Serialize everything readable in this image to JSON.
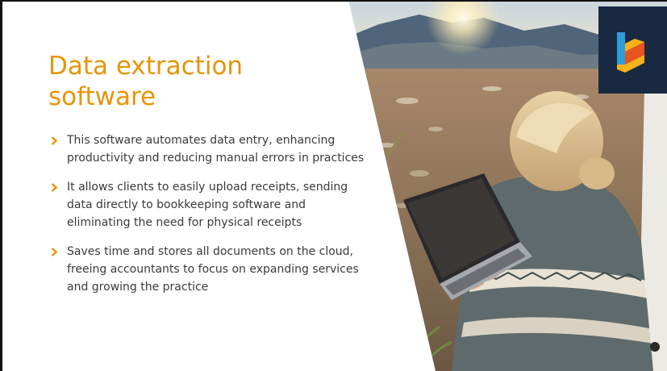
{
  "slide": {
    "title": "Data extraction software",
    "bullets": [
      "This software automates data entry, enhancing productivity and reducing manual errors in practices",
      "It allows clients to easily upload receipts, sending data directly to bookkeeping software and eliminating the need for physical receipts",
      "Saves time and stores all documents on the cloud, freeing accountants to focus on expanding services and growing the practice"
    ]
  },
  "colors": {
    "accent": "#E59508",
    "text": "#3a3a3a",
    "logo_bg": "#1a2942",
    "logo_yellow": "#F6B21B",
    "logo_orange": "#E8541E",
    "logo_blue": "#2D9CDB"
  },
  "icons": {
    "bullet": "chevron-right-icon",
    "logo": "brand-logo-icon"
  }
}
